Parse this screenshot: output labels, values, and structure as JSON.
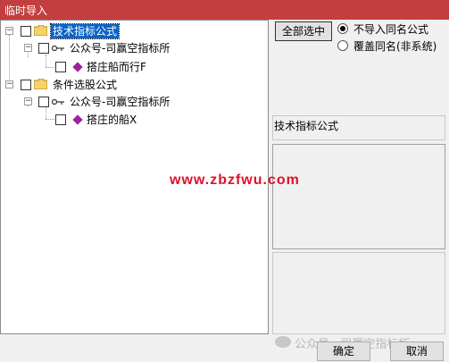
{
  "window": {
    "title": "临时导入"
  },
  "tree": {
    "nodes": [
      {
        "label": "技术指标公式",
        "selected": true
      },
      {
        "label": "公众号-司赢空指标所"
      },
      {
        "label": "搭庄船而行F"
      },
      {
        "label": "条件选股公式"
      },
      {
        "label": "公众号-司赢空指标所"
      },
      {
        "label": "搭庄的船X"
      }
    ],
    "expander_symbol": "−"
  },
  "right": {
    "select_all": "全部选中",
    "options": [
      {
        "label": "不导入同名公式",
        "checked": true
      },
      {
        "label": "覆盖同名(非系统)",
        "checked": false
      }
    ],
    "category_label": "技术指标公式"
  },
  "buttons": {
    "ok": "确定",
    "cancel": "取消"
  },
  "watermarks": {
    "site": "www.zbzfwu.com",
    "wechat": "公众号 · 司赢空指标所"
  },
  "colors": {
    "title_bar": "#c33f3f",
    "selection": "#0a64c8",
    "watermark_red": "#e0102a"
  }
}
